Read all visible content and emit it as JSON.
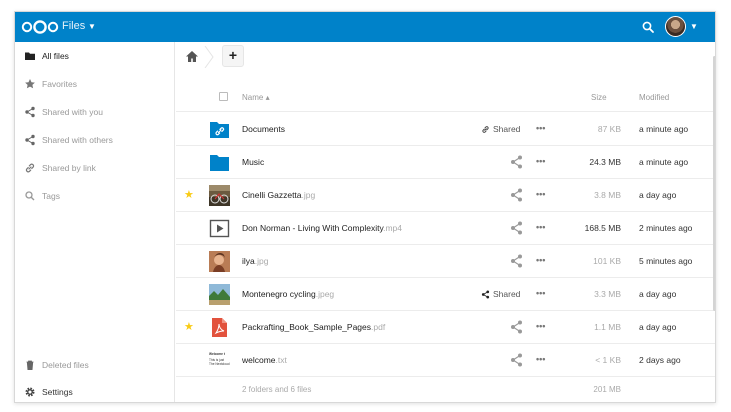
{
  "header": {
    "app_name": "Files",
    "bg": "#0082c9"
  },
  "sidebar": {
    "items": [
      {
        "label": "All files",
        "icon": "folder-icon",
        "active": true
      },
      {
        "label": "Favorites",
        "icon": "star-icon",
        "active": false
      },
      {
        "label": "Shared with you",
        "icon": "share-icon",
        "active": false
      },
      {
        "label": "Shared with others",
        "icon": "share-icon",
        "active": false
      },
      {
        "label": "Shared by link",
        "icon": "link-icon",
        "active": false
      },
      {
        "label": "Tags",
        "icon": "tag-icon",
        "active": false
      }
    ],
    "bottom": [
      {
        "label": "Deleted files",
        "icon": "trash-icon"
      },
      {
        "label": "Settings",
        "icon": "gear-icon"
      }
    ]
  },
  "table": {
    "columns": {
      "name": "Name",
      "size": "Size",
      "modified": "Modified"
    },
    "rows": [
      {
        "name": "Documents",
        "ext": "",
        "type": "folder-link",
        "favorite": false,
        "shared_label": "Shared",
        "size": "87 KB",
        "modified": "a minute ago"
      },
      {
        "name": "Music",
        "ext": "",
        "type": "folder",
        "favorite": false,
        "shared_label": "",
        "size": "24.3 MB",
        "modified": "a minute ago"
      },
      {
        "name": "Cinelli Gazzetta",
        "ext": ".jpg",
        "type": "image-bike",
        "favorite": true,
        "shared_label": "",
        "size": "3.8 MB",
        "modified": "a day ago"
      },
      {
        "name": "Don Norman - Living With Complexity",
        "ext": ".mp4",
        "type": "video",
        "favorite": false,
        "shared_label": "",
        "size": "168.5 MB",
        "modified": "2 minutes ago"
      },
      {
        "name": "ilya",
        "ext": ".jpg",
        "type": "image-portrait",
        "favorite": false,
        "shared_label": "",
        "size": "101 KB",
        "modified": "5 minutes ago"
      },
      {
        "name": "Montenegro cycling",
        "ext": ".jpeg",
        "type": "image-landscape",
        "favorite": false,
        "shared_label": "Shared",
        "size": "3.3 MB",
        "modified": "a day ago"
      },
      {
        "name": "Packrafting_Book_Sample_Pages",
        "ext": ".pdf",
        "type": "pdf",
        "favorite": true,
        "shared_label": "",
        "size": "1.1 MB",
        "modified": "a day ago"
      },
      {
        "name": "welcome",
        "ext": ".txt",
        "type": "text",
        "favorite": false,
        "shared_label": "",
        "size": "< 1 KB",
        "modified": "2 days ago"
      }
    ],
    "text_preview": {
      "line1": "Welcome t",
      "line2": "This is just",
      "line3": "The Nextcloud"
    },
    "summary": {
      "text": "2 folders and 6 files",
      "total": "201 MB"
    }
  }
}
